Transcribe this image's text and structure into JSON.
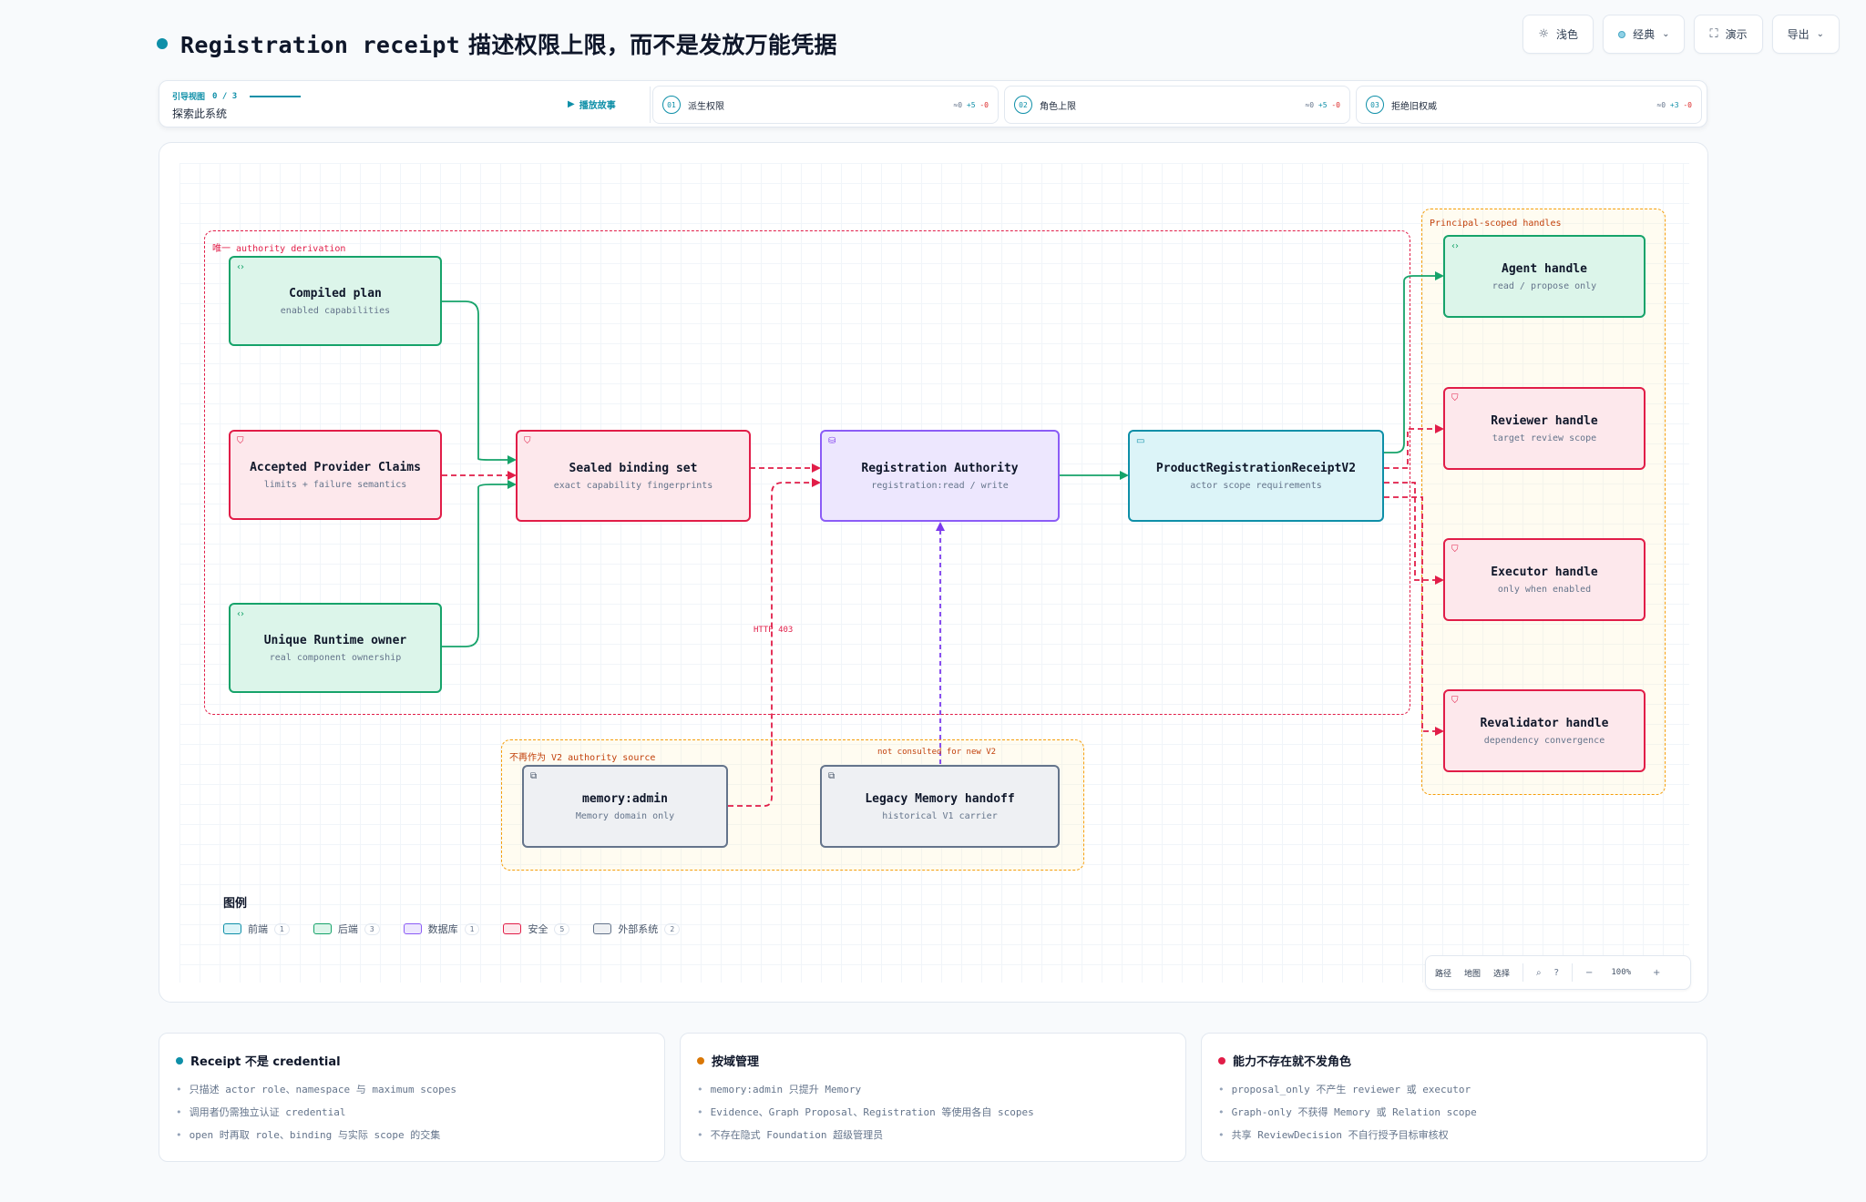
{
  "header": {
    "title_mono": "Registration receipt",
    "title_rest": " 描述权限上限，而不是发放万能凭据",
    "buttons": [
      {
        "label": "浅色",
        "icon": "sun-icon"
      },
      {
        "label": "经典",
        "icon": "palette-dot-icon"
      },
      {
        "label": "演示",
        "icon": "fullscreen-icon"
      },
      {
        "label": "导出",
        "icon": "chevron-down-icon"
      }
    ]
  },
  "story": {
    "guide_label": "引导视图",
    "guide_progress": "0 / 3",
    "guide_sub": "探索此系统",
    "play_label": "播放故事",
    "steps": [
      {
        "num": "01",
        "label": "派生权限",
        "diff_zero": "≈0",
        "diff_plus": "+5",
        "diff_minus": "-0"
      },
      {
        "num": "02",
        "label": "角色上限",
        "diff_zero": "≈0",
        "diff_plus": "+5",
        "diff_minus": "-0"
      },
      {
        "num": "03",
        "label": "拒绝旧权威",
        "diff_zero": "≈0",
        "diff_plus": "+3",
        "diff_minus": "-0"
      }
    ]
  },
  "diagram": {
    "groups": {
      "authority": "唯一 authority derivation",
      "handles": "Principal-scoped handles",
      "legacy": "不再作为 V2 authority source"
    },
    "nodes": {
      "compiled_plan": {
        "title": "Compiled plan",
        "sub": "enabled capabilities"
      },
      "provider_claims": {
        "title": "Accepted Provider Claims",
        "sub": "limits + failure semantics"
      },
      "runtime_owner": {
        "title": "Unique Runtime owner",
        "sub": "real component ownership"
      },
      "sealed_binding": {
        "title": "Sealed binding set",
        "sub": "exact capability fingerprints"
      },
      "registration_authority": {
        "title": "Registration Authority",
        "sub": "registration:read / write"
      },
      "receipt_v2": {
        "title": "ProductRegistrationReceiptV2",
        "sub": "actor scope requirements"
      },
      "agent_handle": {
        "title": "Agent handle",
        "sub": "read / propose only"
      },
      "reviewer_handle": {
        "title": "Reviewer handle",
        "sub": "target review scope"
      },
      "executor_handle": {
        "title": "Executor handle",
        "sub": "only when enabled"
      },
      "revalidator_handle": {
        "title": "Revalidator handle",
        "sub": "dependency convergence"
      },
      "memory_admin": {
        "title": "memory:admin",
        "sub": "Memory domain only"
      },
      "legacy_memory": {
        "title": "Legacy Memory handoff",
        "sub": "historical V1 carrier"
      }
    },
    "edge_labels": {
      "http403": "HTTP 403",
      "not_consulted": "not consulted for new V2"
    },
    "colors": {
      "frontend": "#0e8fa8",
      "backend": "#16a36a",
      "database": "#8b5cf6",
      "security": "#e11d48",
      "external": "#64748b"
    }
  },
  "legend": {
    "title": "图例",
    "items": [
      {
        "label": "前端",
        "count": "1",
        "color": "#0e8fa8",
        "fill": "#dcf4f8"
      },
      {
        "label": "后端",
        "count": "3",
        "color": "#16a36a",
        "fill": "#dcf5ea"
      },
      {
        "label": "数据库",
        "count": "1",
        "color": "#8b5cf6",
        "fill": "#ede7fe"
      },
      {
        "label": "安全",
        "count": "5",
        "color": "#e11d48",
        "fill": "#fde8ec"
      },
      {
        "label": "外部系统",
        "count": "2",
        "color": "#64748b",
        "fill": "#eef0f3"
      }
    ]
  },
  "toolbar": {
    "path": "路径",
    "map": "地图",
    "select": "选择",
    "zoom": "100%",
    "minus": "−",
    "plus": "+"
  },
  "cards": [
    {
      "title": "Receipt 不是 credential",
      "color": "#0e8fa8",
      "items": [
        "只描述 actor role、namespace 与 maximum scopes",
        "调用者仍需独立认证 credential",
        "open 时再取 role、binding 与实际 scope 的交集"
      ]
    },
    {
      "title": "按域管理",
      "color": "#d97706",
      "items": [
        "memory:admin 只提升 Memory",
        "Evidence、Graph Proposal、Registration 等使用各自 scopes",
        "不存在隐式 Foundation 超级管理员"
      ]
    },
    {
      "title": "能力不存在就不发角色",
      "color": "#e11d48",
      "items": [
        "proposal_only 不产生 reviewer 或 executor",
        "Graph-only 不获得 Memory 或 Relation scope",
        "共享 ReviewDecision 不自行授予目标审核权"
      ]
    }
  ]
}
